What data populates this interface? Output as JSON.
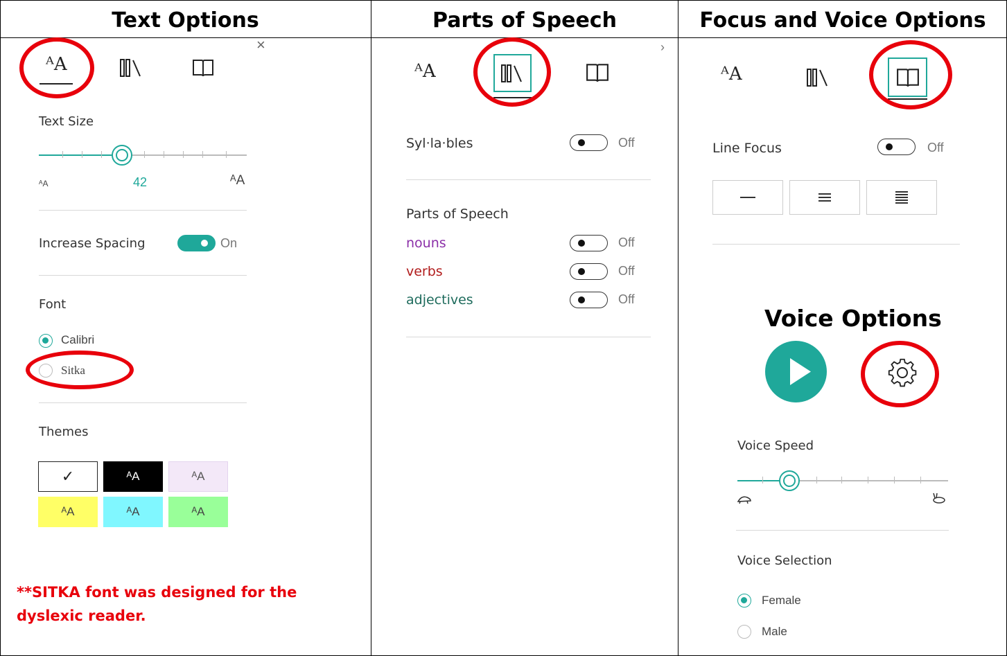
{
  "headers": {
    "text_options": "Text Options",
    "parts_of_speech": "Parts of Speech",
    "focus_voice": "Focus and Voice Options"
  },
  "tabs": {
    "text_icon": "ᴬA",
    "grammar_icon": "books-icon",
    "reading_icon": "open-book-icon"
  },
  "text_panel": {
    "text_size_label": "Text Size",
    "text_size_value": "42",
    "text_size_small": "ᴬA",
    "text_size_large": "ᴬA",
    "text_size_level": 0.4,
    "increase_spacing_label": "Increase Spacing",
    "increase_spacing_state": "On",
    "font_label": "Font",
    "font_options": [
      "Calibri",
      "Sitka"
    ],
    "font_selected": "Calibri",
    "themes_label": "Themes",
    "theme_swatch_text": "ᴬA",
    "theme_colors": [
      "#ffffff",
      "#000000",
      "#f3e8f8",
      "#ffff66",
      "#80f7ff",
      "#99ff99"
    ],
    "note": "**SITKA font was designed for the dyslexic reader."
  },
  "pos_panel": {
    "syllables_label": "Syl·la·bles",
    "syllables_state": "Off",
    "pos_heading": "Parts of Speech",
    "items": [
      {
        "label": "nouns",
        "color": "#8b2fa8",
        "state": "Off"
      },
      {
        "label": "verbs",
        "color": "#b11c1c",
        "state": "Off"
      },
      {
        "label": "adjectives",
        "color": "#1e6b5c",
        "state": "Off"
      }
    ]
  },
  "focus_panel": {
    "line_focus_label": "Line Focus",
    "line_focus_state": "Off",
    "voice_options_title": "Voice Options",
    "voice_speed_label": "Voice Speed",
    "voice_speed_level": 0.25,
    "voice_selection_label": "Voice Selection",
    "voices": [
      "Female",
      "Male"
    ],
    "voice_selected": "Female"
  },
  "colors": {
    "accent": "#1fa89a",
    "highlight_circle": "#e8000b"
  }
}
